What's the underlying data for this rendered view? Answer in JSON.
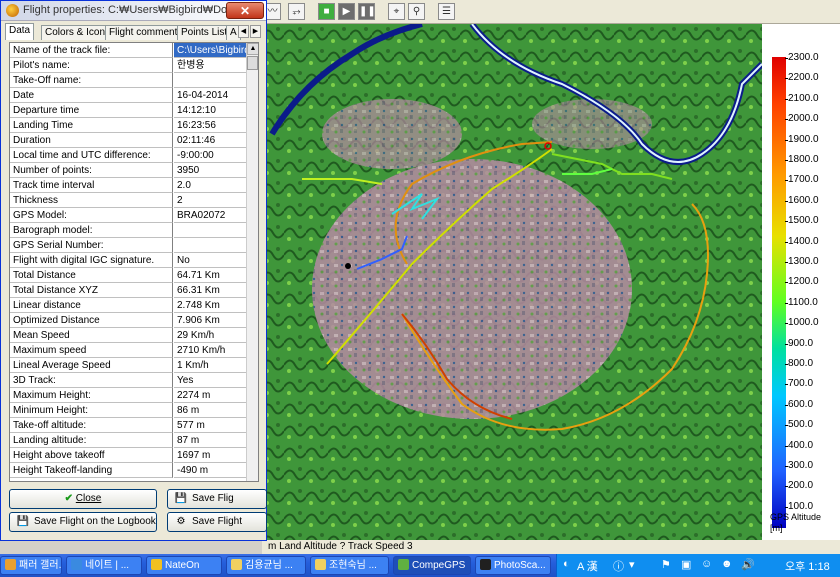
{
  "dialog": {
    "title": "Flight properties: C:₩Users₩Bigbird₩Docum...",
    "tabs": [
      "Data",
      "Colors & Icons",
      "Flight comments:",
      "Points List",
      "A"
    ],
    "rows": [
      {
        "label": "Name of the track file:",
        "value": "C:\\Users\\Bigbird\\D"
      },
      {
        "label": "Pilot's name:",
        "value": "한병용"
      },
      {
        "label": "Take-Off name:",
        "value": ""
      },
      {
        "label": "Date",
        "value": "16-04-2014"
      },
      {
        "label": "Departure time",
        "value": "14:12:10"
      },
      {
        "label": "Landing Time",
        "value": "16:23:56"
      },
      {
        "label": "Duration",
        "value": "02:11:46"
      },
      {
        "label": "Local time and UTC difference:",
        "value": "-9:00:00"
      },
      {
        "label": "Number of points:",
        "value": "3950"
      },
      {
        "label": "Track time interval",
        "value": "2.0"
      },
      {
        "label": "Thickness",
        "value": "2"
      },
      {
        "label": "GPS Model:",
        "value": "BRA02072"
      },
      {
        "label": "Barograph model:",
        "value": ""
      },
      {
        "label": "GPS Serial Number:",
        "value": ""
      },
      {
        "label": "Flight with digital IGC signature.",
        "value": "No"
      },
      {
        "label": "Total Distance",
        "value": "64.71 Km"
      },
      {
        "label": "Total Distance XYZ",
        "value": "66.31 Km"
      },
      {
        "label": "Linear distance",
        "value": "2.748 Km"
      },
      {
        "label": "Optimized Distance",
        "value": "7.906 Km"
      },
      {
        "label": "Mean Speed",
        "value": "29 Km/h"
      },
      {
        "label": "Maximum speed",
        "value": "2710 Km/h"
      },
      {
        "label": "Lineal Average Speed",
        "value": "1 Km/h"
      },
      {
        "label": "3D Track:",
        "value": "Yes"
      },
      {
        "label": "Maximum Height:",
        "value": "2274 m"
      },
      {
        "label": "Minimum Height:",
        "value": "86 m"
      },
      {
        "label": "Take-off altitude:",
        "value": "577 m"
      },
      {
        "label": "Landing altitude:",
        "value": "87 m"
      },
      {
        "label": "Height above takeoff",
        "value": "1697 m"
      },
      {
        "label": "Height Takeoff-landing",
        "value": "-490 m"
      }
    ],
    "buttons": {
      "close": "Close",
      "save_flight": "Save Flig",
      "save_logbook": "Save Flight on the Logbook",
      "save_flight2": "Save Flight"
    }
  },
  "legend": {
    "ticks": [
      "2300.0",
      "2200.0",
      "2100.0",
      "2000.0",
      "1900.0",
      "1800.0",
      "1700.0",
      "1600.0",
      "1500.0",
      "1400.0",
      "1300.0",
      "1200.0",
      "1100.0",
      "1000.0",
      "900.0",
      "800.0",
      "700.0",
      "600.0",
      "500.0",
      "400.0",
      "300.0",
      "200.0",
      "100.0"
    ],
    "title": "GPS Altitude",
    "unit": "[m]"
  },
  "statusbar": {
    "text": "m Land Altitude ? Track Speed 3"
  },
  "taskbar": {
    "items": [
      {
        "label": "패러 갤러...",
        "color": "#e8a030"
      },
      {
        "label": "네이트 | ...",
        "color": "#3a8ae0"
      },
      {
        "label": "NateOn",
        "color": "#f0c020"
      },
      {
        "label": "김용균님 ...",
        "color": "#f0d060"
      },
      {
        "label": "조현숙님 ...",
        "color": "#f0d060"
      },
      {
        "label": "CompeGPS",
        "color": "#60b040"
      },
      {
        "label": "PhotoSca...",
        "color": "#202020"
      }
    ],
    "tray": {
      "lang": "A 漢",
      "time": "오후 1:18"
    }
  }
}
